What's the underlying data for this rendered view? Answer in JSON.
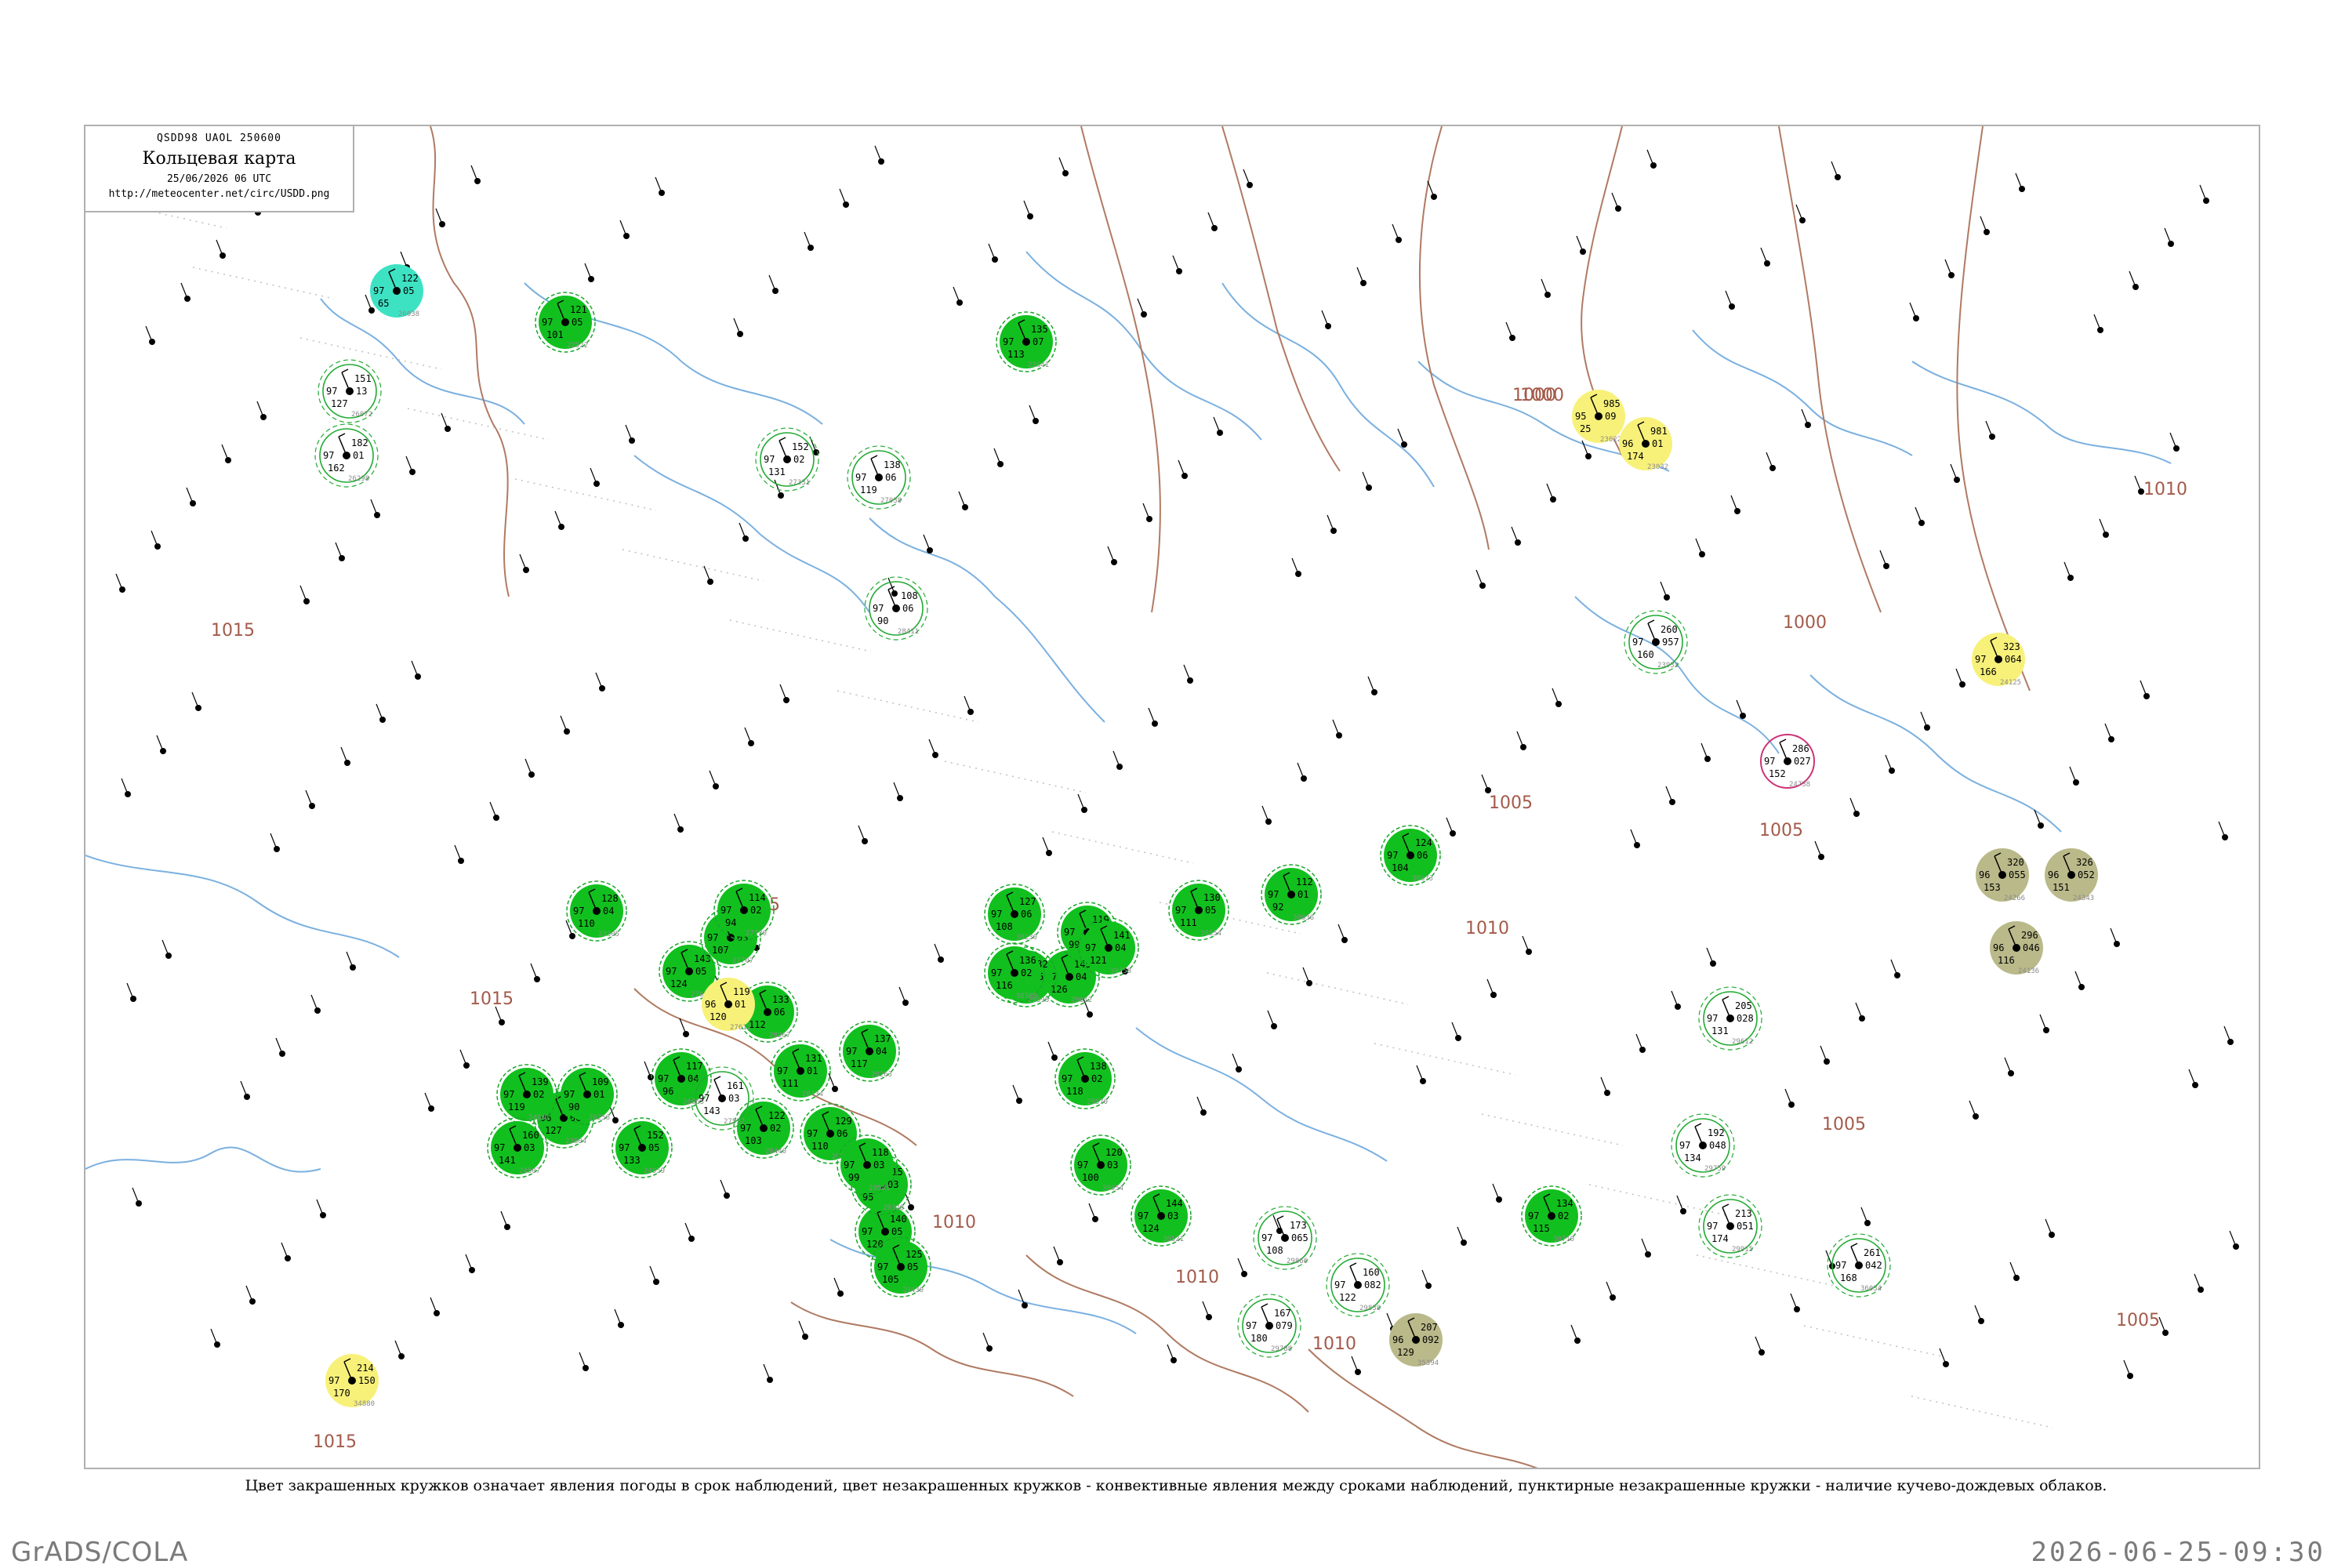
{
  "title": {
    "code": "QSDD98 UAOL 250600",
    "name": "Кольцевая карта",
    "date": "25/06/2026 06 UTC",
    "url": "http://meteocenter.net/circ/USDD.png"
  },
  "caption": "Цвет закрашенных кружков означает явления погоды в срок наблюдений, цвет незакрашенных кружков - конвективные явления между сроками наблюдений, пунктирные незакрашенные кружки - наличие кучево-дождевых облаков.",
  "footer": {
    "left": "GrADS/COLA",
    "right": "2026-06-25-09:30"
  },
  "colors": {
    "rain_fill": "#11c01e",
    "rain_ring": "#1aa62a",
    "convective_ring": "#22aa33",
    "fog_yellow": "#f7f17a",
    "haze_olive": "#b9b98a",
    "cyan": "#3de2c3",
    "thunder_magenta": "#cc3377",
    "coastline": "#7ab0e0",
    "isobar": "#a35a4a",
    "border": "#b0b0b0"
  },
  "isobars": [
    {
      "label": "1015"
    },
    {
      "label": "1015"
    },
    {
      "label": "1015"
    },
    {
      "label": "1015"
    },
    {
      "label": "1010"
    },
    {
      "label": "1010"
    },
    {
      "label": "1010"
    },
    {
      "label": "1005"
    },
    {
      "label": "1005"
    },
    {
      "label": "1005"
    },
    {
      "label": "1005"
    },
    {
      "label": "1000"
    },
    {
      "label": "1000"
    },
    {
      "label": "1000"
    },
    {
      "label": "1010"
    },
    {
      "label": "1010"
    }
  ],
  "stations": [
    {
      "kind": "rain",
      "top": "121",
      "left": "97",
      "right": "05",
      "bot": "101",
      "id": "22522"
    },
    {
      "kind": "rain",
      "top": "135",
      "left": "97",
      "right": "07",
      "bot": "113",
      "id": "22641"
    },
    {
      "kind": "rain",
      "top": "128",
      "left": "97",
      "right": "04",
      "bot": "110",
      "id": "23305"
    },
    {
      "kind": "rain",
      "top": "146",
      "left": "96",
      "right": "06",
      "bot": "127",
      "id": "23804"
    },
    {
      "kind": "rain",
      "top": "139",
      "left": "97",
      "right": "02",
      "bot": "119",
      "id": "24641"
    },
    {
      "kind": "rain",
      "top": "160",
      "left": "97",
      "right": "03",
      "bot": "141",
      "id": "24507"
    },
    {
      "kind": "rain",
      "top": "152",
      "left": "97",
      "right": "05",
      "bot": "133",
      "id": "24959"
    },
    {
      "kind": "rain",
      "top": "117",
      "left": "97",
      "right": "04",
      "bot": "96",
      "id": "26063"
    },
    {
      "kind": "rain",
      "top": "109",
      "left": "97",
      "right": "01",
      "bot": "90",
      "id": "26258"
    },
    {
      "kind": "rain",
      "top": "143",
      "left": "97",
      "right": "05",
      "bot": "124",
      "id": "27612"
    },
    {
      "kind": "rain",
      "top": "126",
      "left": "97",
      "right": "03",
      "bot": "107",
      "id": "27707"
    },
    {
      "kind": "rain",
      "top": "114",
      "left": "97",
      "right": "02",
      "bot": "94",
      "id": "27730"
    },
    {
      "kind": "rain",
      "top": "133",
      "left": "97",
      "right": "06",
      "bot": "112",
      "id": "28367"
    },
    {
      "kind": "rain",
      "top": "131",
      "left": "97",
      "right": "01",
      "bot": "111",
      "id": "28434"
    },
    {
      "kind": "rain",
      "top": "122",
      "left": "97",
      "right": "02",
      "bot": "103",
      "id": "28440"
    },
    {
      "kind": "rain",
      "top": "140",
      "left": "97",
      "right": "05",
      "bot": "120",
      "id": "29231"
    },
    {
      "kind": "rain",
      "top": "137",
      "left": "97",
      "right": "04",
      "bot": "117",
      "id": "29263"
    },
    {
      "kind": "rain",
      "top": "129",
      "left": "97",
      "right": "06",
      "bot": "110",
      "id": "29282"
    },
    {
      "kind": "rain",
      "top": "115",
      "left": "97",
      "right": "03",
      "bot": "95",
      "id": "29328"
    },
    {
      "kind": "rain",
      "top": "125",
      "left": "97",
      "right": "05",
      "bot": "105",
      "id": "29430"
    },
    {
      "kind": "rain",
      "top": "118",
      "left": "97",
      "right": "03",
      "bot": "99",
      "id": "29541"
    },
    {
      "kind": "rain",
      "top": "138",
      "left": "97",
      "right": "02",
      "bot": "118",
      "id": "29570"
    },
    {
      "kind": "rain",
      "top": "145",
      "left": "97",
      "right": "04",
      "bot": "126",
      "id": "29612"
    },
    {
      "kind": "rain",
      "top": "132",
      "left": "97",
      "right": "05",
      "bot": "113",
      "id": "29698"
    },
    {
      "kind": "rain",
      "top": "120",
      "left": "97",
      "right": "03",
      "bot": "100",
      "id": "30054"
    },
    {
      "kind": "rain",
      "top": "127",
      "left": "97",
      "right": "06",
      "bot": "108",
      "id": "30230"
    },
    {
      "kind": "rain",
      "top": "136",
      "left": "97",
      "right": "02",
      "bot": "116",
      "id": "30309"
    },
    {
      "kind": "rain",
      "top": "119",
      "left": "97",
      "right": "04",
      "bot": "99",
      "id": "30393"
    },
    {
      "kind": "rain",
      "top": "144",
      "left": "97",
      "right": "03",
      "bot": "124",
      "id": "30521"
    },
    {
      "kind": "rain",
      "top": "130",
      "left": "97",
      "right": "05",
      "bot": "111",
      "id": "30554"
    },
    {
      "kind": "rain",
      "top": "112",
      "left": "97",
      "right": "01",
      "bot": "92",
      "id": "30636"
    },
    {
      "kind": "rain",
      "top": "124",
      "left": "97",
      "right": "06",
      "bot": "104",
      "id": "30673"
    },
    {
      "kind": "rain",
      "top": "134",
      "left": "97",
      "right": "02",
      "bot": "115",
      "id": "30710"
    },
    {
      "kind": "rain",
      "top": "141",
      "left": "97",
      "right": "04",
      "bot": "121",
      "id": "30758"
    },
    {
      "kind": "fog",
      "top": "119",
      "left": "96",
      "right": "01",
      "bot": "120",
      "id": "27612"
    },
    {
      "kind": "fog",
      "top": "985",
      "left": "95",
      "right": "09",
      "bot": "25",
      "id": "23022"
    },
    {
      "kind": "fog",
      "top": "981",
      "left": "96",
      "right": "01",
      "bot": "174",
      "id": "23032"
    },
    {
      "kind": "fog",
      "top": "323",
      "left": "97",
      "right": "064",
      "bot": "166",
      "id": "24125"
    },
    {
      "kind": "fog",
      "top": "214",
      "left": "97",
      "right": "150",
      "bot": "170",
      "id": "34880"
    },
    {
      "kind": "haze",
      "top": "320",
      "left": "96",
      "right": "055",
      "bot": "153",
      "id": "24266"
    },
    {
      "kind": "haze",
      "top": "326",
      "left": "96",
      "right": "052",
      "bot": "151",
      "id": "24343"
    },
    {
      "kind": "haze",
      "top": "296",
      "left": "96",
      "right": "046",
      "bot": "116",
      "id": "24136"
    },
    {
      "kind": "haze",
      "top": "207",
      "left": "96",
      "right": "092",
      "bot": "129",
      "id": "35394"
    },
    {
      "kind": "cyan",
      "top": "122",
      "left": "97",
      "right": "05",
      "bot": "65",
      "id": "26038"
    },
    {
      "kind": "thunder",
      "top": "286",
      "left": "97",
      "right": "027",
      "bot": "152",
      "id": "24738"
    },
    {
      "kind": "ring",
      "top": "151",
      "left": "97",
      "right": "13",
      "bot": "127",
      "id": "26072"
    },
    {
      "kind": "ring",
      "top": "182",
      "left": "97",
      "right": "01",
      "bot": "162",
      "id": "26298"
    },
    {
      "kind": "ring",
      "top": "138",
      "left": "97",
      "right": "06",
      "bot": "119",
      "id": "27038"
    },
    {
      "kind": "ring",
      "top": "152",
      "left": "97",
      "right": "02",
      "bot": "131",
      "id": "27331"
    },
    {
      "kind": "ring",
      "top": "161",
      "left": "97",
      "right": "03",
      "bot": "143",
      "id": "27532"
    },
    {
      "kind": "ring",
      "top": "108",
      "left": "97",
      "right": "06",
      "bot": "90",
      "id": "28411"
    },
    {
      "kind": "ring",
      "top": "167",
      "left": "97",
      "right": "079",
      "bot": "180",
      "id": "29788"
    },
    {
      "kind": "ring",
      "top": "173",
      "left": "97",
      "right": "065",
      "bot": "108",
      "id": "29866"
    },
    {
      "kind": "ring",
      "top": "160",
      "left": "97",
      "right": "082",
      "bot": "122",
      "id": "29838"
    },
    {
      "kind": "ring",
      "top": "205",
      "left": "97",
      "right": "028",
      "bot": "131",
      "id": "29612"
    },
    {
      "kind": "ring",
      "top": "192",
      "left": "97",
      "right": "048",
      "bot": "134",
      "id": "29759"
    },
    {
      "kind": "ring",
      "top": "260",
      "left": "97",
      "right": "957",
      "bot": "160",
      "id": "23933"
    },
    {
      "kind": "ring",
      "top": "213",
      "left": "97",
      "right": "051",
      "bot": "174",
      "id": "29915"
    },
    {
      "kind": "ring",
      "top": "261",
      "left": "97",
      "right": "042",
      "bot": "168",
      "id": "36034"
    }
  ]
}
